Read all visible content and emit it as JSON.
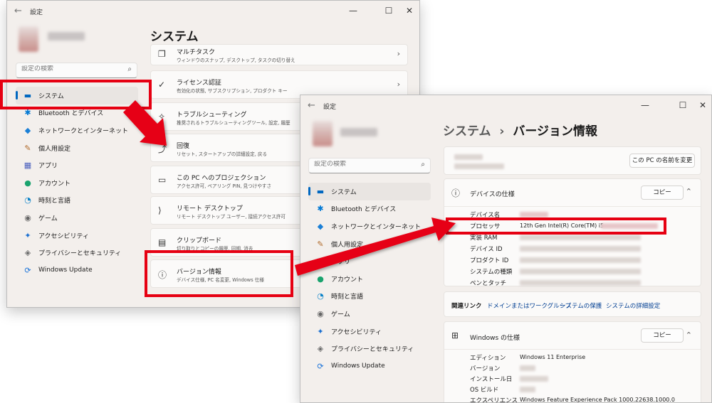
{
  "w1": {
    "title": "設定",
    "back_glyph": "←",
    "controls": [
      "—",
      "☐",
      "✕"
    ],
    "search_placeholder": "設定の検索",
    "page_title": "システム",
    "nav": [
      {
        "label": "システム",
        "icon": "▬"
      },
      {
        "label": "Bluetooth とデバイス",
        "icon": "✱"
      },
      {
        "label": "ネットワークとインターネット",
        "icon": "◆"
      },
      {
        "label": "個人用設定",
        "icon": "✎"
      },
      {
        "label": "アプリ",
        "icon": "▦"
      },
      {
        "label": "アカウント",
        "icon": "●"
      },
      {
        "label": "時刻と言語",
        "icon": "◔"
      },
      {
        "label": "ゲーム",
        "icon": "◉"
      },
      {
        "label": "アクセシビリティ",
        "icon": "✦"
      },
      {
        "label": "プライバシーとセキュリティ",
        "icon": "◈"
      },
      {
        "label": "Windows Update",
        "icon": "⟳"
      }
    ],
    "cards": [
      {
        "title": "マルチタスク",
        "sub": "ウィンドウのスナップ, デスクトップ, タスクの切り替え",
        "icon": "❐"
      },
      {
        "title": "ライセンス認証",
        "sub": "有効化の状態, サブスクリプション, プロダクト キー",
        "icon": "✓"
      },
      {
        "title": "トラブルシューティング",
        "sub": "推奨されるトラブルシューティングツール, 設定, 履歴",
        "icon": "✧"
      },
      {
        "title": "回復",
        "sub": "リセット, スタートアップの詳細設定, 戻る",
        "icon": "⤴"
      },
      {
        "title": "この PC へのプロジェクション",
        "sub": "アクセス許可, ペアリング PIN, 見つけやすさ",
        "icon": "▭"
      },
      {
        "title": "リモート デスクトップ",
        "sub": "リモート デスクトップ ユーザー, 接続アクセス許可",
        "icon": "⟩"
      },
      {
        "title": "クリップボード",
        "sub": "切り取りとコピーの履歴, 同期, 消去",
        "icon": "▤"
      },
      {
        "title": "バージョン情報",
        "sub": "デバイス仕様, PC 名変更, Windows 仕様",
        "icon": "ⓘ"
      }
    ]
  },
  "w2": {
    "title": "設定",
    "back_glyph": "←",
    "controls": [
      "—",
      "☐",
      "✕"
    ],
    "search_placeholder": "設定の検索",
    "breadcrumb_parent": "システム",
    "breadcrumb_sep": "›",
    "breadcrumb_current": "バージョン情報",
    "rename_button": "この PC の名前を変更",
    "copy_label": "コピー",
    "device_spec_title": "デバイスの仕様",
    "device_specs": [
      {
        "label": "デバイス名",
        "value": ""
      },
      {
        "label": "プロセッサ",
        "value": "12th Gen Intel(R) Core(TM) i5"
      },
      {
        "label": "実装 RAM",
        "value": ""
      },
      {
        "label": "デバイス ID",
        "value": ""
      },
      {
        "label": "プロダクト ID",
        "value": ""
      },
      {
        "label": "システムの種類",
        "value": ""
      },
      {
        "label": "ペンとタッチ",
        "value": ""
      }
    ],
    "related_label": "関連リンク",
    "related_links": [
      "ドメインまたはワークグループ",
      "システムの保護",
      "システムの詳細設定"
    ],
    "win_spec_title": "Windows の仕様",
    "win_specs": [
      {
        "label": "エディション",
        "value": "Windows 11 Enterprise"
      },
      {
        "label": "バージョン",
        "value": ""
      },
      {
        "label": "インストール日",
        "value": ""
      },
      {
        "label": "OS ビルド",
        "value": ""
      },
      {
        "label": "エクスペリエンス",
        "value": "Windows Feature Experience Pack 1000.22638.1000.0"
      }
    ],
    "nav": [
      {
        "label": "システム",
        "icon": "▬"
      },
      {
        "label": "Bluetooth とデバイス",
        "icon": "✱"
      },
      {
        "label": "ネットワークとインターネット",
        "icon": "◆"
      },
      {
        "label": "個人用設定",
        "icon": "✎"
      },
      {
        "label": "アプリ",
        "icon": "▦"
      },
      {
        "label": "アカウント",
        "icon": "●"
      },
      {
        "label": "時刻と言語",
        "icon": "◔"
      },
      {
        "label": "ゲーム",
        "icon": "◉"
      },
      {
        "label": "アクセシビリティ",
        "icon": "✦"
      },
      {
        "label": "プライバシーとセキュリティ",
        "icon": "◈"
      },
      {
        "label": "Windows Update",
        "icon": "⟳"
      }
    ]
  },
  "colors": {
    "accent": "#0067c0",
    "highlight": "#e60012",
    "link": "#003e92"
  }
}
